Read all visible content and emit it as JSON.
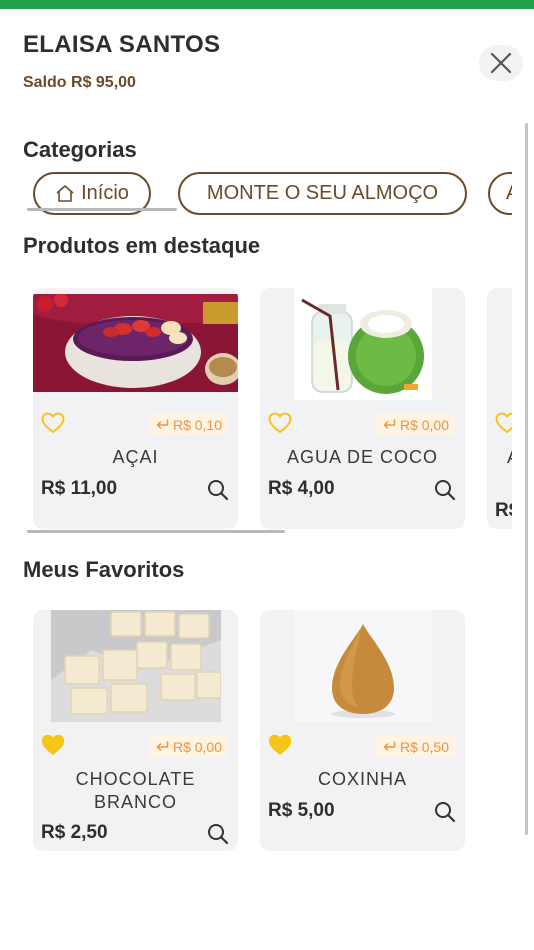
{
  "user": {
    "name": "ELAISA SANTOS",
    "balance": "Saldo R$ 95,00"
  },
  "colors": {
    "brand_green": "#1fa34a",
    "brown": "#6b4a2a",
    "cashback_orange": "#f0953a",
    "heart_yellow": "#f5c518"
  },
  "sections": {
    "categories": "Categorias",
    "featured": "Produtos em destaque",
    "favorites": "Meus Favoritos"
  },
  "categories": [
    {
      "label": "Início",
      "icon": "home-icon"
    },
    {
      "label": "MONTE O SEU ALMOÇO"
    },
    {
      "label": "A"
    }
  ],
  "featured": [
    {
      "name": "AÇAI",
      "price": "R$ 11,00",
      "cashback": "R$ 0,10",
      "favorite": false
    },
    {
      "name": "AGUA DE COCO",
      "price": "R$ 4,00",
      "cashback": "R$ 0,00",
      "favorite": false
    },
    {
      "name": "A",
      "price": "R$"
    }
  ],
  "favorites": [
    {
      "name_line1": "CHOCOLATE",
      "name_line2": "BRANCO",
      "price": "R$ 2,50",
      "cashback": "R$ 0,00",
      "favorite": true
    },
    {
      "name": "COXINHA",
      "price": "R$ 5,00",
      "cashback": "R$ 0,50",
      "favorite": true
    }
  ]
}
